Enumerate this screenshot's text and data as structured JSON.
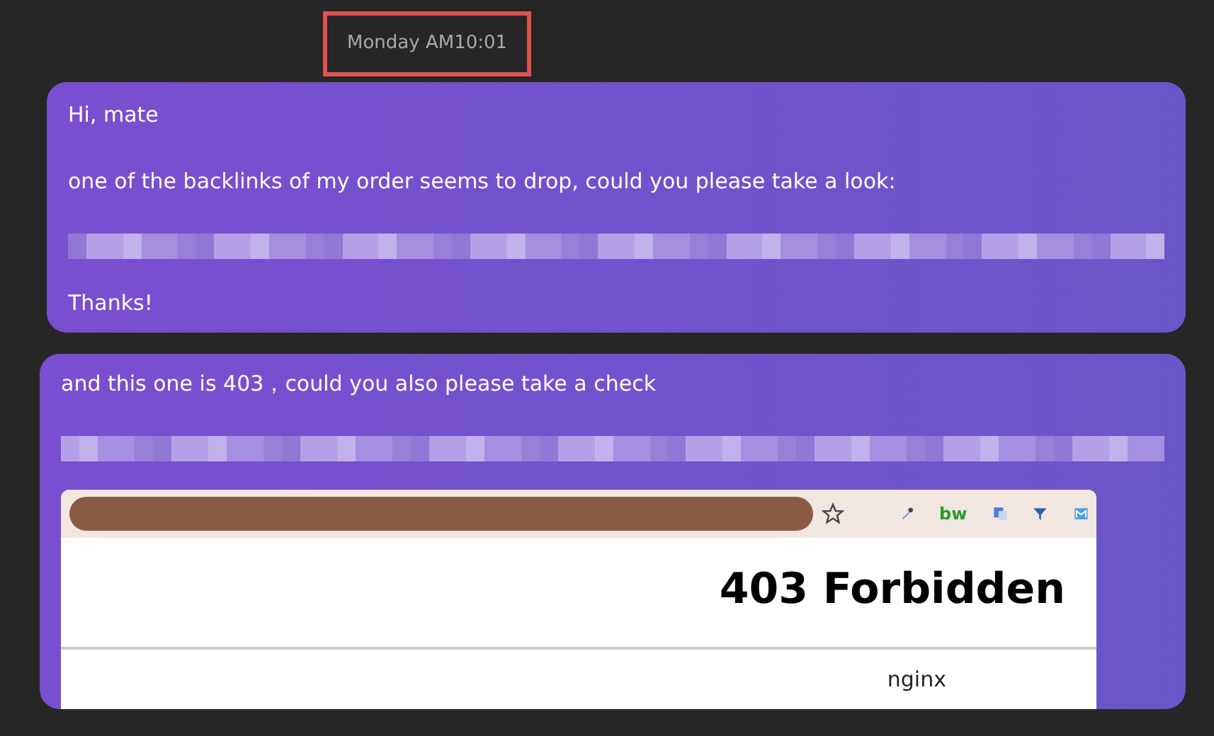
{
  "timestamp": {
    "text": "Monday AM10:01",
    "highlighted": true
  },
  "messages": [
    {
      "kind": "text",
      "lines": [
        {
          "kind": "text",
          "text": "Hi, mate"
        },
        {
          "kind": "text",
          "text": "one of the backlinks of my order seems to drop, could you please take a look:"
        },
        {
          "kind": "redacted"
        },
        {
          "kind": "text",
          "text": "Thanks!"
        }
      ]
    },
    {
      "kind": "text",
      "lines": [
        {
          "kind": "text",
          "text": "and this one is 403，could you also please take a check"
        },
        {
          "kind": "redacted"
        },
        {
          "kind": "screenshot"
        }
      ]
    }
  ],
  "screenshot": {
    "extensions": [
      {
        "kind": "dropper"
      },
      {
        "kind": "label",
        "text": "bw"
      },
      {
        "kind": "translate"
      },
      {
        "kind": "funnel"
      },
      {
        "kind": "mail"
      }
    ],
    "heading": "403 Forbidden",
    "server": "nginx"
  }
}
